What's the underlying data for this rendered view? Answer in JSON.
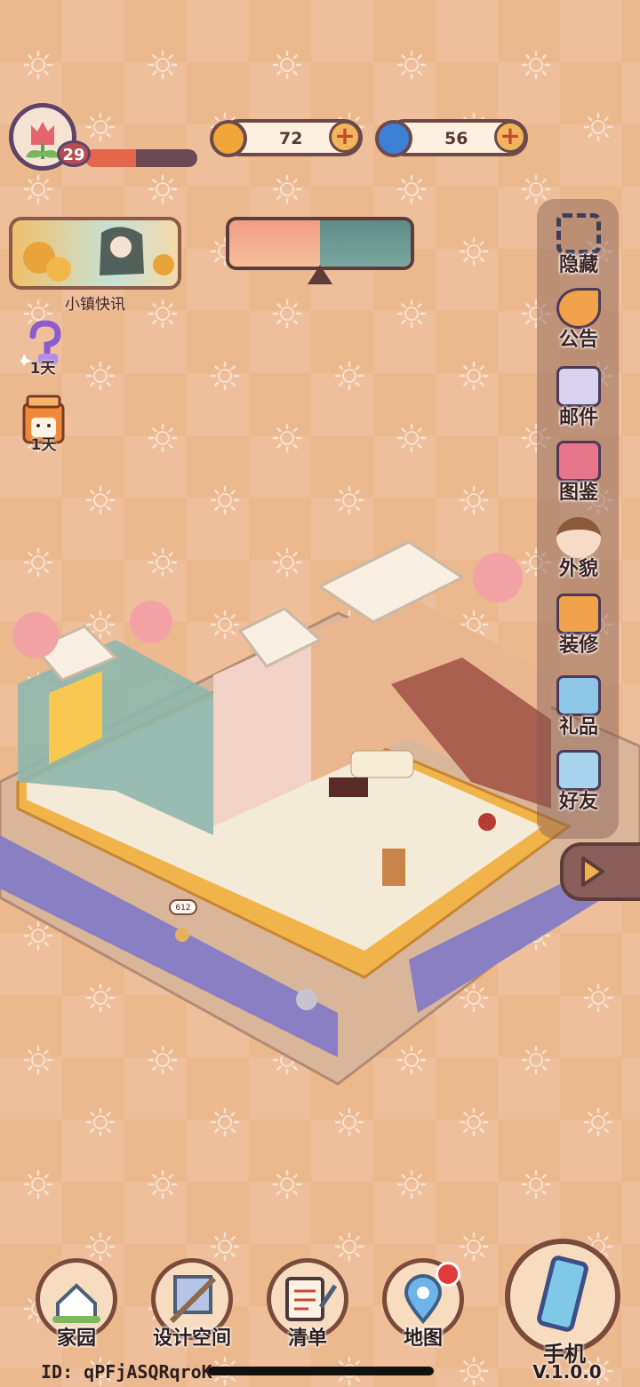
{
  "player": {
    "level": "29",
    "xp_fraction": 0.45
  },
  "currency": {
    "coins": {
      "value": "72",
      "icon": "gold-coin-icon"
    },
    "gems": {
      "value": "56",
      "icon": "blue-swirl-icon"
    }
  },
  "news": {
    "label": "小镇快讯"
  },
  "events": [
    {
      "label": "1天",
      "icon": "question-mystery-icon"
    },
    {
      "label": "1天",
      "icon": "milk-carton-icon"
    }
  ],
  "sidebar": {
    "items": [
      {
        "label": "隐藏",
        "icon": "hide-frame-icon"
      },
      {
        "label": "公告",
        "icon": "announcement-horn-icon"
      },
      {
        "label": "邮件",
        "icon": "mail-envelope-icon"
      },
      {
        "label": "图鉴",
        "icon": "catalog-book-icon"
      },
      {
        "label": "外貌",
        "icon": "avatar-face-icon"
      },
      {
        "label": "装修",
        "icon": "house-wrench-icon"
      },
      {
        "label": "礼品",
        "icon": "gift-box-icon"
      },
      {
        "label": "好友",
        "icon": "friend-book-icon"
      }
    ]
  },
  "world": {
    "npc_bubble": "612"
  },
  "nav": [
    {
      "label": "家园",
      "icon": "home-house-icon"
    },
    {
      "label": "设计空间",
      "icon": "design-ruler-icon"
    },
    {
      "label": "清单",
      "icon": "list-quill-icon"
    },
    {
      "label": "地图",
      "icon": "map-pin-icon"
    }
  ],
  "phone": {
    "label": "手机",
    "version": "V.1.0.0"
  },
  "user_id": "ID: qPFjASQRqroK",
  "colors": {
    "background": "#ecb88e",
    "accent_dark": "#5d4468",
    "xp_fill": "#e4664c",
    "notification": "#e23b3b"
  }
}
